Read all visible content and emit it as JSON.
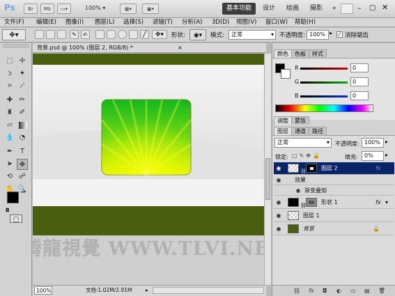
{
  "app": {
    "logo": "Ps",
    "icons": [
      "Br",
      "Mb"
    ],
    "zoom": "100%",
    "workspaces": [
      "基本功能",
      "设计",
      "绘画",
      "摄影"
    ],
    "more": "»"
  },
  "menu": [
    "文件(F)",
    "编辑(E)",
    "图像(I)",
    "图层(L)",
    "选择(S)",
    "滤镜(T)",
    "分析(A)",
    "3D(D)",
    "视图(V)",
    "窗口(W)",
    "帮助(H)"
  ],
  "options": {
    "shape_label": "形状:",
    "mode_label": "模式:",
    "mode_value": "正常",
    "opacity_label": "不透明度:",
    "opacity_value": "100%",
    "antialias_label": "消除锯齿"
  },
  "document": {
    "tab_title": "背景.psd @ 100% (图层 2, RGB/8) *",
    "close": "×",
    "watermark": "腾龍視覺 WWW.TLVI.NET",
    "status_zoom": "100%",
    "status_doc": "文档:1.02M/2.91M"
  },
  "color_panel": {
    "tabs": [
      "颜色",
      "色板",
      "样式"
    ],
    "channels": [
      {
        "label": "R",
        "value": "0",
        "color": "#cc0000"
      },
      {
        "label": "G",
        "value": "0",
        "color": "#00a000"
      },
      {
        "label": "B",
        "value": "0",
        "color": "#0033cc"
      }
    ]
  },
  "adjust_panel": {
    "tabs": [
      "调整",
      "蒙版"
    ]
  },
  "layers_panel": {
    "tabs": [
      "图层",
      "通道",
      "路径"
    ],
    "blend_mode": "正常",
    "opacity_label": "不透明度:",
    "opacity_value": "100%",
    "lock_label": "锁定:",
    "fill_label": "填充:",
    "fill_value": "0%",
    "layers": [
      {
        "name": "图层 2",
        "fx": "fx",
        "selected": true,
        "thumb": "transparent"
      },
      {
        "name": "效果",
        "sub": true
      },
      {
        "name": "渐变叠加",
        "sub": true,
        "subsub": true
      },
      {
        "name": "形状 1",
        "fx": "fx",
        "thumb": "black"
      },
      {
        "name": "图层 1",
        "thumb": "transparent"
      },
      {
        "name": "背景",
        "italic": true,
        "locked": true,
        "thumb": "green"
      }
    ]
  },
  "colors": {
    "dark_green": "#4a5e10",
    "bright_green": "#1fc21f",
    "yellow_green": "#d8ef00",
    "selection_blue": "#0a246a"
  }
}
